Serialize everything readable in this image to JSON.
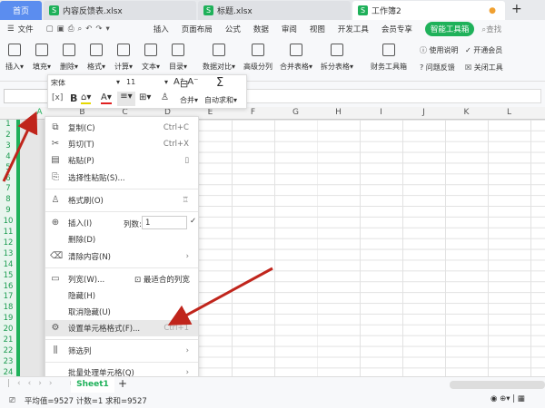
{
  "tabs": [
    {
      "label": "首页"
    },
    {
      "label": "内容反馈表.xlsx"
    },
    {
      "label": "标题.xlsx"
    },
    {
      "label": "工作簿2"
    }
  ],
  "menu": {
    "file": "文件",
    "items": [
      "插入",
      "页面布局",
      "公式",
      "数据",
      "审阅",
      "视图",
      "开发工具",
      "会员专享"
    ],
    "smart": "智能工具箱",
    "search": "查找"
  },
  "ribbon": {
    "left": [
      "插入",
      "填充",
      "删除",
      "格式",
      "计算",
      "文本",
      "目录"
    ],
    "mid": [
      "数据对比",
      "高级分列",
      "合并表格",
      "拆分表格"
    ],
    "finance": "财务工具箱",
    "right": [
      "使用说明",
      "开通会员",
      "问题反馈",
      "关闭工具"
    ]
  },
  "mini": {
    "font": "宋体",
    "size": "11",
    "merge": "合并",
    "autosum": "自动求和",
    "bold": "B",
    "fontcolor": "A"
  },
  "columns": [
    "A",
    "B",
    "C",
    "D",
    "E",
    "F",
    "G",
    "H",
    "I",
    "J",
    "K",
    "L"
  ],
  "rows": [
    "1",
    "2",
    "3",
    "4",
    "5",
    "6",
    "7",
    "8",
    "9",
    "10",
    "11",
    "12",
    "13",
    "14",
    "15",
    "16",
    "17",
    "18",
    "19",
    "20",
    "21",
    "22",
    "23",
    "24"
  ],
  "context_menu": {
    "copy": {
      "label": "复制(C)",
      "shortcut": "Ctrl+C"
    },
    "cut": {
      "label": "剪切(T)",
      "shortcut": "Ctrl+X"
    },
    "paste": {
      "label": "粘贴(P)"
    },
    "paste_special": {
      "label": "选择性粘贴(S)..."
    },
    "format_painter": {
      "label": "格式刷(O)"
    },
    "insert": {
      "label": "插入(I)",
      "count_label": "列数:",
      "count_value": "1"
    },
    "delete": {
      "label": "删除(D)"
    },
    "clear": {
      "label": "清除内容(N)"
    },
    "col_width": {
      "label": "列宽(W)...",
      "fit": "最适合的列宽"
    },
    "hide": {
      "label": "隐藏(H)"
    },
    "unhide": {
      "label": "取消隐藏(U)"
    },
    "format_cells": {
      "label": "设置单元格格式(F)...",
      "shortcut": "Ctrl+1"
    },
    "filter": {
      "label": "筛选列"
    },
    "batch": {
      "label": "批量处理单元格(Q)"
    }
  },
  "sheet": {
    "name": "Sheet1",
    "add": "+"
  },
  "status": {
    "avg": "平均值=9527",
    "count": "计数=1",
    "sum": "求和=9527"
  },
  "colors": {
    "accent": "#1fb15a",
    "home_tab": "#5b8def",
    "arrow": "#c0251c"
  }
}
